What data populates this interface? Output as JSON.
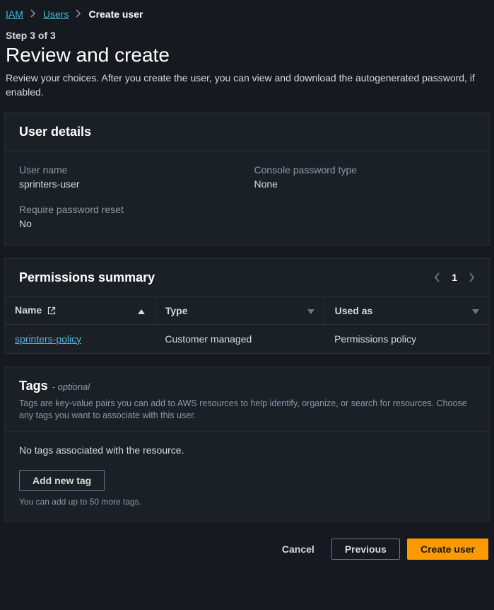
{
  "breadcrumb": {
    "root": "IAM",
    "users": "Users",
    "current": "Create user"
  },
  "step": "Step 3 of 3",
  "title": "Review and create",
  "description": "Review your choices. After you create the user, you can view and download the autogenerated password, if enabled.",
  "user_details": {
    "heading": "User details",
    "username_label": "User name",
    "username_value": "sprinters-user",
    "pwtype_label": "Console password type",
    "pwtype_value": "None",
    "reset_label": "Require password reset",
    "reset_value": "No"
  },
  "permissions": {
    "heading": "Permissions summary",
    "page": "1",
    "cols": {
      "name": "Name",
      "type": "Type",
      "used_as": "Used as"
    },
    "rows": [
      {
        "name": "sprinters-policy",
        "type": "Customer managed",
        "used_as": "Permissions policy"
      }
    ]
  },
  "tags": {
    "heading": "Tags",
    "optional": "- optional",
    "description": "Tags are key-value pairs you can add to AWS resources to help identify, organize, or search for resources. Choose any tags you want to associate with this user.",
    "empty": "No tags associated with the resource.",
    "add_btn": "Add new tag",
    "hint": "You can add up to 50 more tags."
  },
  "footer": {
    "cancel": "Cancel",
    "previous": "Previous",
    "create": "Create user"
  }
}
